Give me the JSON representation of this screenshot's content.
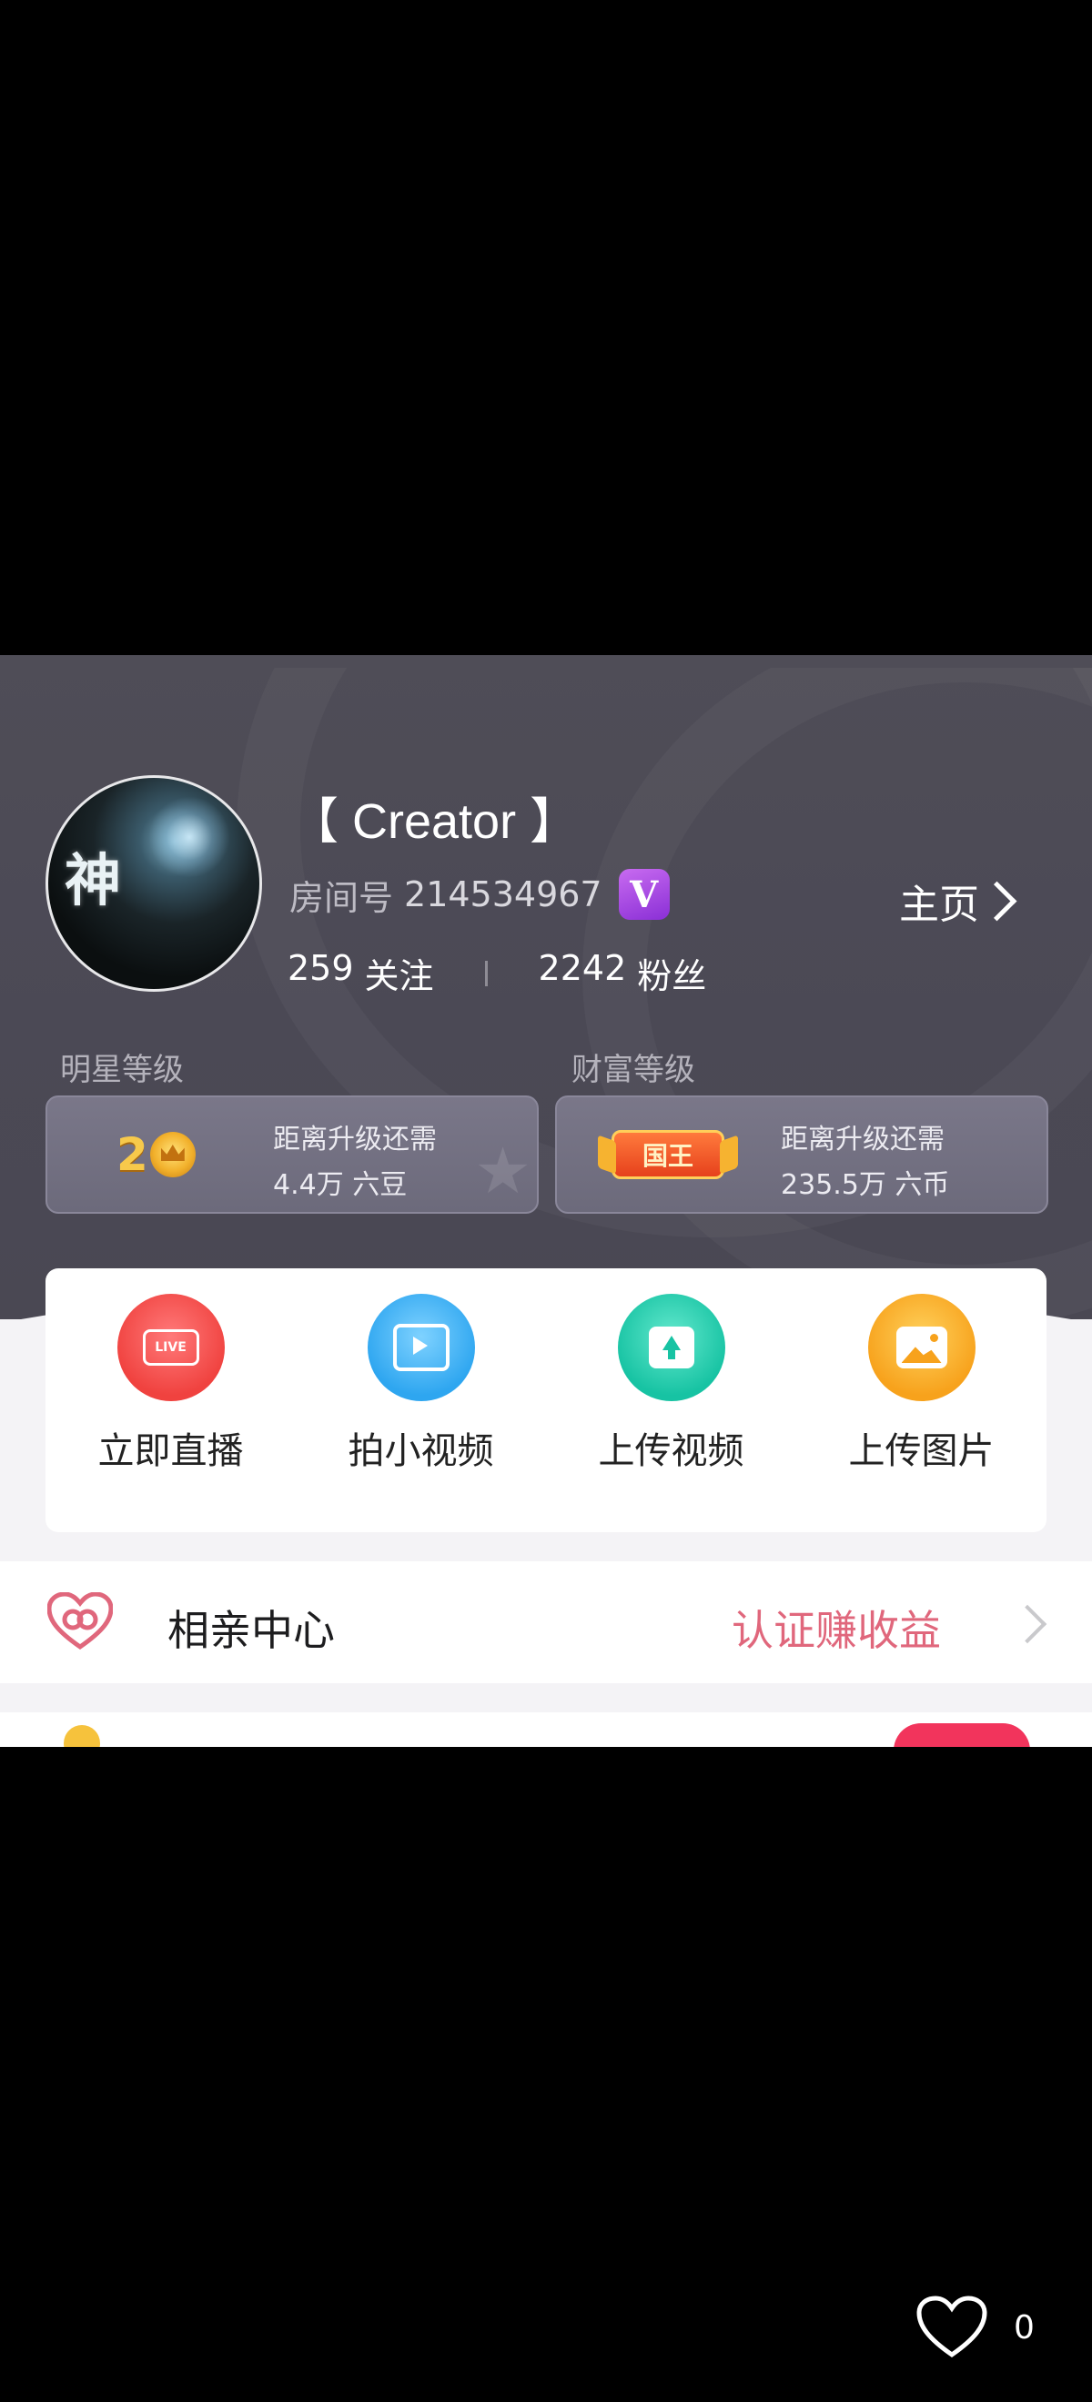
{
  "profile": {
    "username": "【 Creator 】",
    "room_label": "房间号",
    "room_id": "214534967",
    "vip_badge": "V",
    "homepage_label": "主页",
    "following_count": "259",
    "following_label": "关注",
    "fans_count": "2242",
    "fans_label": "粉丝",
    "avatar_glyph": "神"
  },
  "levels": {
    "star": {
      "title": "明星等级",
      "level": "2",
      "line1": "距离升级还需",
      "line2": "4.4万 六豆"
    },
    "wealth": {
      "title": "财富等级",
      "badge": "国王",
      "line1": "距离升级还需",
      "line2": "235.5万 六币"
    }
  },
  "actions": [
    {
      "label": "立即直播",
      "icon": "live-camera-icon",
      "chip": "LIVE",
      "color": "#f0423f"
    },
    {
      "label": "拍小视频",
      "icon": "video-film-icon",
      "color": "#2ea6f0"
    },
    {
      "label": "上传视频",
      "icon": "upload-video-icon",
      "color": "#17c3a3"
    },
    {
      "label": "上传图片",
      "icon": "upload-image-icon",
      "color": "#f7a21c"
    }
  ],
  "matchmaking": {
    "title": "相亲中心",
    "action": "认证赚收益",
    "icon": "heart-rings-icon",
    "accent": "#e0677c"
  },
  "overlay": {
    "like_icon": "heart-outline-icon",
    "like_count": "0"
  },
  "colors": {
    "header_bg": "#4b4955",
    "vip": "#8a2fd6",
    "panel_bg": "#ffffff"
  }
}
